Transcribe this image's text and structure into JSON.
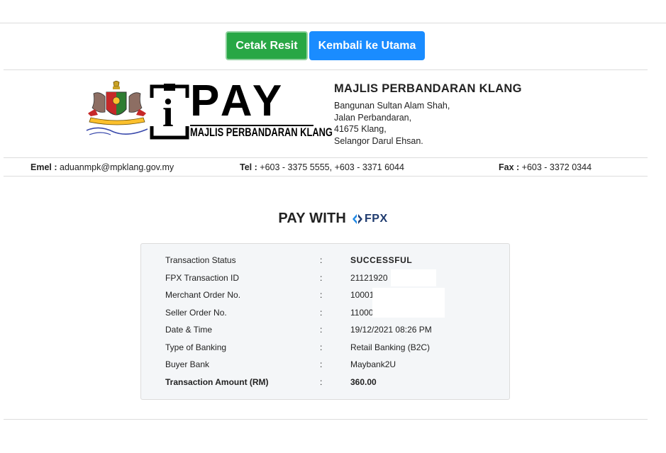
{
  "actions": {
    "print_label": "Cetak Resit",
    "home_label": "Kembali ke Utama"
  },
  "logo": {
    "brand": "PAY",
    "brand_letter": "i",
    "subtitle": "MAJLIS PERBANDARAN KLANG",
    "crest_icon": "municipal-crest-icon"
  },
  "organization": {
    "name": "MAJLIS PERBANDARAN KLANG",
    "address": [
      "Bangunan Sultan Alam Shah,",
      "Jalan Perbandaran,",
      "41675 Klang,",
      "Selangor Darul Ehsan."
    ]
  },
  "contact": {
    "email_label": "Emel :",
    "email": "aduanmpk@mpklang.gov.my",
    "tel_label": "Tel :",
    "tel": "+603 - 3375 5555, +603 - 3371 6044",
    "fax_label": "Fax :",
    "fax": "+603 - 3372 0344"
  },
  "payment": {
    "heading": "PAY WITH",
    "method": "FPX",
    "colon": ":",
    "rows": [
      {
        "label": "Transaction Status",
        "value": "SUCCESSFUL"
      },
      {
        "label": "FPX Transaction ID",
        "value": "21121920"
      },
      {
        "label": "Merchant Order No.",
        "value": "10001"
      },
      {
        "label": "Seller Order No.",
        "value": "11000"
      },
      {
        "label": "Date & Time",
        "value": "19/12/2021 08:26 PM"
      },
      {
        "label": "Type of Banking",
        "value": "Retail Banking (B2C)"
      },
      {
        "label": "Buyer Bank",
        "value": "Maybank2U"
      },
      {
        "label": "Transaction Amount (RM)",
        "value": "360.00"
      }
    ]
  },
  "colors": {
    "print_button": "#28a745",
    "home_button": "#1a8cff",
    "fpx_brand": "#1e3a6e",
    "card_background": "#f4f6f8"
  }
}
